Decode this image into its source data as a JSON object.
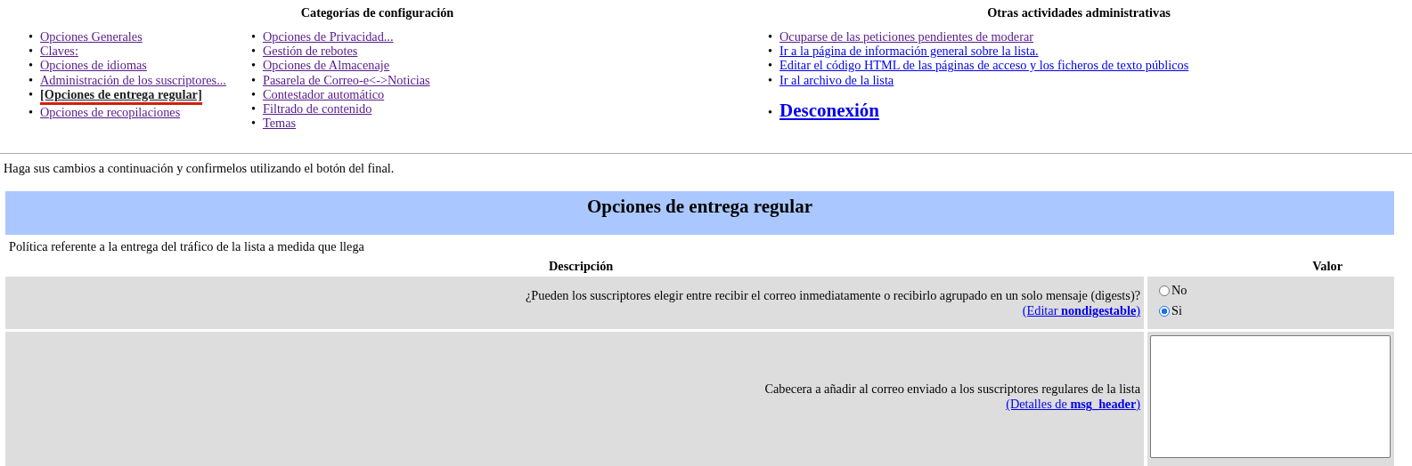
{
  "config_categories": {
    "title": "Categorías de configuración",
    "columns": [
      [
        {
          "marker": "•",
          "label": "Opciones Generales",
          "selected": false,
          "visited": true
        },
        {
          "marker": "•",
          "label": "Claves:",
          "selected": false,
          "visited": true
        },
        {
          "marker": "•",
          "label": "Opciones de idiomas",
          "selected": false,
          "visited": true
        },
        {
          "marker": "•",
          "label": "Administración de los suscriptores...",
          "selected": false,
          "visited": true
        },
        {
          "marker": "•",
          "label": "[Opciones de entrega regular]",
          "selected": true,
          "visited": true
        },
        {
          "marker": "•",
          "label": "Opciones de recopilaciones",
          "selected": false,
          "visited": true
        }
      ],
      [
        {
          "marker": "•",
          "label": "Opciones de Privacidad...",
          "selected": false,
          "visited": true
        },
        {
          "marker": "•",
          "label": "Gestión de rebotes",
          "selected": false,
          "visited": true
        },
        {
          "marker": "•",
          "label": "Opciones de Almacenaje",
          "selected": false,
          "visited": true
        },
        {
          "marker": "•",
          "label": "Pasarela de Correo-e<->Noticias",
          "selected": false,
          "visited": true
        },
        {
          "marker": "•",
          "label": "Contestador automático",
          "selected": false,
          "visited": true
        },
        {
          "marker": "•",
          "label": "Filtrado de contenido",
          "selected": false,
          "visited": true
        },
        {
          "marker": "•",
          "label": "Temas",
          "selected": false,
          "visited": true
        }
      ]
    ]
  },
  "other_activities": {
    "title": "Otras actividades administrativas",
    "items": [
      {
        "marker": "•",
        "label": "Ocuparse de las peticiones pendientes de moderar",
        "visited": true
      },
      {
        "marker": "•",
        "label": "Ir a la página de información general sobre la lista.",
        "visited": false
      },
      {
        "marker": "•",
        "label": "Editar el código HTML de las páginas de acceso y los ficheros de texto públicos",
        "visited": false
      },
      {
        "marker": "•",
        "label": "Ir al archivo de la lista",
        "visited": false
      }
    ],
    "logout": {
      "marker": "•",
      "label": "Desconexión"
    }
  },
  "instructions": "Haga sus cambios a continuación y confirmelos utilizando el botón del final.",
  "section": {
    "title": "Opciones de entrega regular",
    "description": "Política referente a la entrega del tráfico de la lista a medida que llega",
    "columns": [
      "Descripción",
      "Valor"
    ],
    "rows": [
      {
        "kind": "radio",
        "question": "¿Pueden los suscriptores elegir entre recibir el correo inmediatamente o recibirlo agrupado en un solo mensaje (digests)?",
        "link": "(Editar **nondigestable**)",
        "options": [
          {
            "label": "No",
            "selected": false
          },
          {
            "label": "Si",
            "selected": true
          }
        ]
      },
      {
        "kind": "textarea",
        "question": "Cabecera a añadir al correo enviado a los suscriptores regulares de la lista",
        "link": "(Detalles de **msg_header**)"
      }
    ]
  }
}
